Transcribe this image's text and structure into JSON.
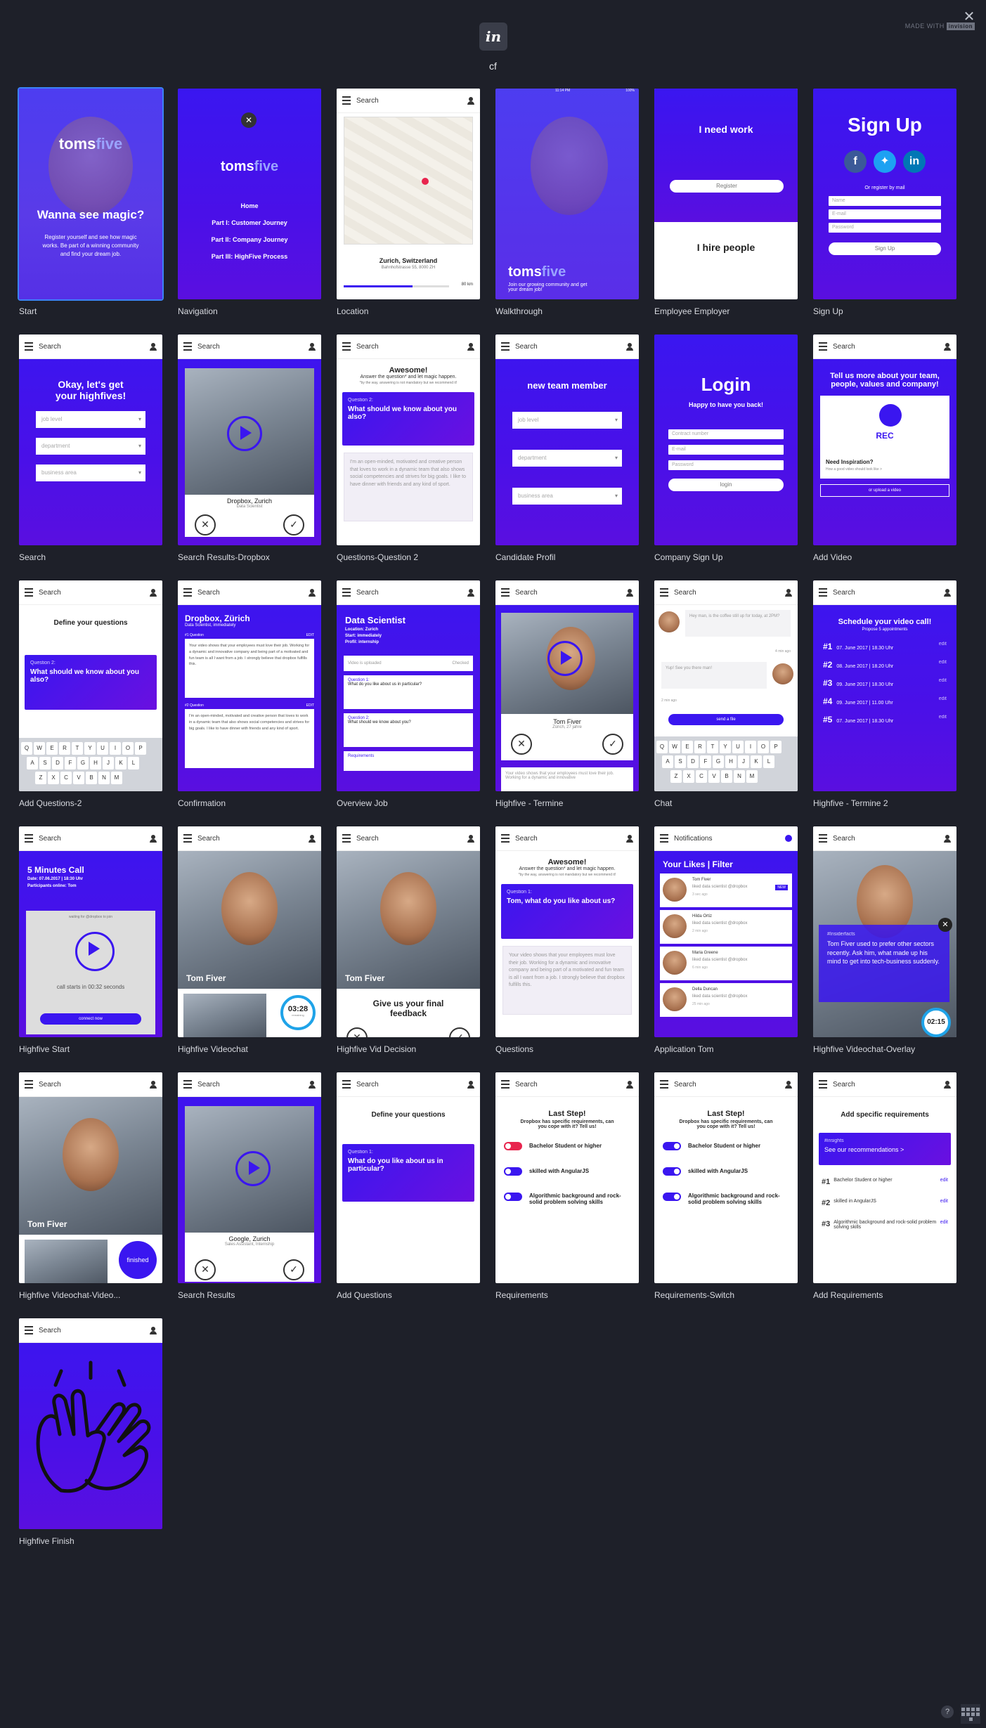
{
  "project_name": "cf",
  "logo_text": "in",
  "made_with": "MADE WITH",
  "made_with_brand": "invision",
  "help_label": "?",
  "screens": [
    {
      "label": "Start",
      "headline": "Wanna see magic?",
      "brand1": "toms",
      "brand2": "five",
      "body": "Register yourself and see how magic works. Be part of a winning community and find your dream job."
    },
    {
      "label": "Navigation",
      "brand1": "toms",
      "brand2": "five",
      "items": [
        "Home",
        "Part I: Customer Journey",
        "Part II: Company Journey",
        "Part III: HighFive Process"
      ]
    },
    {
      "label": "Location",
      "search": "Search",
      "city": "Zurich, Switzerland",
      "address": "Bahnhofstrasse 55, 8000 ZH",
      "distance": "80 km"
    },
    {
      "label": "Walkthrough",
      "time": "11:14 PM",
      "battery": "100%",
      "brand1": "toms",
      "brand2": "five",
      "body": "Join our growing community and get your dream job!"
    },
    {
      "label": "Employee Employer",
      "top": "I need work",
      "button": "Register",
      "bottom": "I hire people"
    },
    {
      "label": "Sign Up",
      "title": "Sign Up",
      "or": "Or register by mail",
      "fields": [
        "Name",
        "E-mail",
        "Password"
      ],
      "button": "Sign Up"
    },
    {
      "label": "Search",
      "search": "Search",
      "headline": "Okay, let's get your highfives!",
      "selects": [
        "job level",
        "department",
        "business area"
      ]
    },
    {
      "label": "Search Results-Dropbox",
      "search": "Search",
      "company": "Dropbox, Zurich",
      "role": "Data Scientist"
    },
    {
      "label": "Questions-Question 2",
      "search": "Search",
      "title": "Awesome!",
      "subtitle": "Answer the question* and let magic happen.",
      "note": "*by the way, answering is not mandatory but we recommend it!",
      "qlabel": "Question 2:",
      "question": "What should we know about you also?",
      "answer": "I'm an open-minded, motivated and creative person that loves to work in a dynamic team that also shows social competencies and strives for big goals. I like to have dinner with friends and any kind of sport."
    },
    {
      "label": "Candidate Profil",
      "search": "Search",
      "title": "new team member",
      "selects": [
        "job level",
        "department",
        "business area"
      ]
    },
    {
      "label": "Company Sign Up",
      "title": "Login",
      "subtitle": "Happy to have you back!",
      "fields": [
        "Contract number",
        "E-mail",
        "Password"
      ],
      "button": "login"
    },
    {
      "label": "Add Video",
      "search": "Search",
      "headline": "Tell us more about your team, people, values and company!",
      "rec": "REC",
      "inspire": "Need Inspiration?",
      "inspire_sub": "How a good video should look like >",
      "upload": "or upload a video"
    },
    {
      "label": "Add Questions-2",
      "search": "Search",
      "title": "Define your questions",
      "qlabel": "Question 2:",
      "question": "What should we know about you also?",
      "keys1": [
        "Q",
        "W",
        "E",
        "R",
        "T",
        "Y",
        "U",
        "I",
        "O",
        "P"
      ],
      "keys2": [
        "A",
        "S",
        "D",
        "F",
        "G",
        "H",
        "J",
        "K",
        "L"
      ],
      "keys3": [
        "Z",
        "X",
        "C",
        "V",
        "B",
        "N",
        "M"
      ]
    },
    {
      "label": "Confirmation",
      "search": "Search",
      "title": "Dropbox, Zürich",
      "subtitle": "Data Scientist, immediately",
      "q1": "#1 Question",
      "edit": "EDIT",
      "a1": "Your video shows that your employees must love their job. Working for a dynamic and innovative company and being part of a motivated and fun team is all I want from a job. I strongly believe that dropbox fulfills this.",
      "q2": "#2 Question",
      "a2": "I'm an open-minded, motivated and creative person that loves to work in a dynamic team that also shows social competencies and strives for big goals. I like to have dinner with friends and any kind of sport."
    },
    {
      "label": "Overview Job",
      "search": "Search",
      "title": "Data Scientist",
      "location": "Location: Zurich",
      "start": "Start: immediately",
      "profil": "Profil: internship",
      "video": "Video is uploaded",
      "checked": "Checked",
      "q1l": "Question 1:",
      "q1": "What do you like about us in particular?",
      "q2l": "Question 2:",
      "q2": "What should we know about you?",
      "req": "Requirements"
    },
    {
      "label": "Highfive - Termine",
      "search": "Search",
      "name": "Tom Fiver",
      "info": "Zürich, 27 jahre",
      "excerpt": "Your video shows that your employees must love their job. Working for a dynamic and innovative"
    },
    {
      "label": "Chat",
      "search": "Search",
      "msg1": "Hey man, is the coffee still up for today, at 2PM?",
      "time1": "4 min ago",
      "msg2": "Yup! See you there man!",
      "time2": "2 min ago",
      "button": "send a file"
    },
    {
      "label": "Highfive - Termine 2",
      "search": "Search",
      "title": "Schedule your video call!",
      "subtitle": "Propose 5 appointments",
      "dates": [
        [
          "#1",
          "07. June 2017 | 18.30 Uhr"
        ],
        [
          "#2",
          "08. June 2017 | 18.20 Uhr"
        ],
        [
          "#3",
          "09. June 2017 | 18.30 Uhr"
        ],
        [
          "#4",
          "09. June 2017 | 11.00 Uhr"
        ],
        [
          "#5",
          "07. June 2017 | 18.30 Uhr"
        ]
      ],
      "edit": "edit"
    },
    {
      "label": "Highfive Start",
      "search": "Search",
      "title": "5 Minutes Call",
      "date": "Date: 07.06.2017 | 18:30 Uhr",
      "participants": "Participants online: Tom",
      "waiting": "waiting for @dropbox to join",
      "countdown": "call starts in 00:32 seconds",
      "button": "connect now"
    },
    {
      "label": "Highfive Videochat",
      "search": "Search",
      "name": "Tom Fiver",
      "timer": "03:28",
      "timer_sub": "remaining"
    },
    {
      "label": "Highfive Vid Decision",
      "search": "Search",
      "name": "Tom Fiver",
      "prompt": "Give us your final feedback"
    },
    {
      "label": "Questions",
      "search": "Search",
      "title": "Awesome!",
      "subtitle": "Answer the question* and let magic happen.",
      "note": "*by the way, answering is not mandatory but we recommend it!",
      "qlabel": "Question 1:",
      "question": "Tom, what do you like about us?",
      "answer": "Your video shows that your employees must love their job. Working for a dynamic and innovative company and being part of a motivated and fun team is all I want from a job. I strongly believe that dropbox fulfills this."
    },
    {
      "label": "Application Tom",
      "search": "Notifications",
      "title": "Your Likes | Filter",
      "likes": [
        [
          "Tom Fiver",
          "liked data scientist @dropbox",
          "3 sec ago"
        ],
        [
          "Hilda Ortiz",
          "liked data scientist @dropbox",
          "2 min ago"
        ],
        [
          "Maria Greene",
          "liked data scientist @dropbox",
          "6 min ago"
        ],
        [
          "Della Duncan",
          "liked data scientist @dropbox",
          "25 min ago"
        ]
      ],
      "new": "NEW"
    },
    {
      "label": "Highfive Videochat-Overlay",
      "search": "Search",
      "hashtag": "#Insiderfacts",
      "text": "Tom Fiver used to prefer other sectors recently. Ask him, what made up his mind to get into tech-business suddenly.",
      "timer": "02:15"
    },
    {
      "label": "Highfive Videochat-Video...",
      "search": "Search",
      "name": "Tom Fiver",
      "badge": "finished"
    },
    {
      "label": "Search Results",
      "search": "Search",
      "company": "Google, Zurich",
      "role": "Sales Assistant, Internship"
    },
    {
      "label": "Add Questions",
      "search": "Search",
      "title": "Define your questions",
      "qlabel": "Question 1:",
      "question": "What do you like about us in particular?"
    },
    {
      "label": "Requirements",
      "search": "Search",
      "title": "Last Step!",
      "subtitle": "Dropbox has specific requirements, can you cope with it? Tell us!",
      "reqs": [
        "Bachelor Student or higher",
        "skilled with AngularJS",
        "Algorithmic background and rock-solid problem solving skills"
      ]
    },
    {
      "label": "Requirements-Switch",
      "search": "Search",
      "title": "Last Step!",
      "subtitle": "Dropbox has specific requirements, can you cope with it? Tell us!",
      "reqs": [
        "Bachelor Student or higher",
        "skilled with AngularJS",
        "Algorithmic background and rock-solid problem solving skills"
      ]
    },
    {
      "label": "Add Requirements",
      "search": "Search",
      "title": "Add specific requirements",
      "tag": "#insights",
      "rec": "See our recommendations >",
      "reqs": [
        [
          "#1",
          "Bachelor Student or higher"
        ],
        [
          "#2",
          "skilled in AngularJS"
        ],
        [
          "#3",
          "Algorithmic background and rock-solid problem solving skills"
        ]
      ],
      "edit": "edit"
    },
    {
      "label": "Highfive Finish",
      "search": "Search"
    }
  ]
}
